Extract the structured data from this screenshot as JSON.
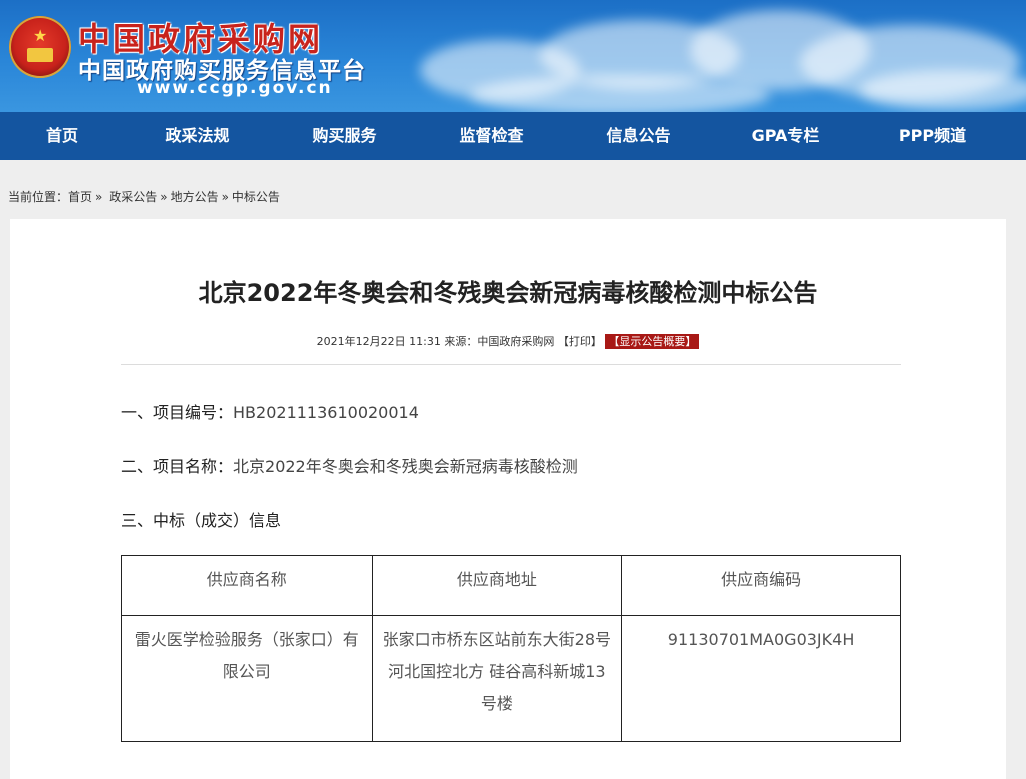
{
  "header": {
    "title": "中国政府采购网",
    "subtitle": "中国政府购买服务信息平台",
    "url": "www.ccgp.gov.cn"
  },
  "nav": {
    "items": [
      "首页",
      "政采法规",
      "购买服务",
      "监督检查",
      "信息公告",
      "GPA专栏",
      "PPP频道"
    ]
  },
  "breadcrumb": {
    "prefix": "当前位置：",
    "items": [
      "首页",
      "政采公告",
      "地方公告",
      "中标公告"
    ],
    "separator": "»"
  },
  "article": {
    "title": "北京2022年冬奥会和冬残奥会新冠病毒核酸检测中标公告",
    "meta": "2021年12月22日 11:31 来源：中国政府采购网",
    "print_label": "【打印】",
    "summary_label": "【显示公告概要】",
    "project_no_label": "一、项目编号：",
    "project_no": "HB2021113610020014",
    "project_name_label": "二、项目名称：",
    "project_name": "北京2022年冬奥会和冬残奥会新冠病毒核酸检测",
    "award_label": "三、中标（成交）信息",
    "table": {
      "headers": [
        "供应商名称",
        "供应商地址",
        "供应商编码"
      ],
      "rows": [
        [
          "雷火医学检验服务（张家口）有限公司",
          "张家口市桥东区站前东大街28号河北国控北方 硅谷高科新城13号楼",
          "91130701MA0G03JK4H"
        ]
      ]
    }
  },
  "colors": {
    "nav_bg": "#1455a0",
    "banner_bg": "#2a86d8",
    "title_red": "#c8231c",
    "badge_red": "#a81916"
  }
}
